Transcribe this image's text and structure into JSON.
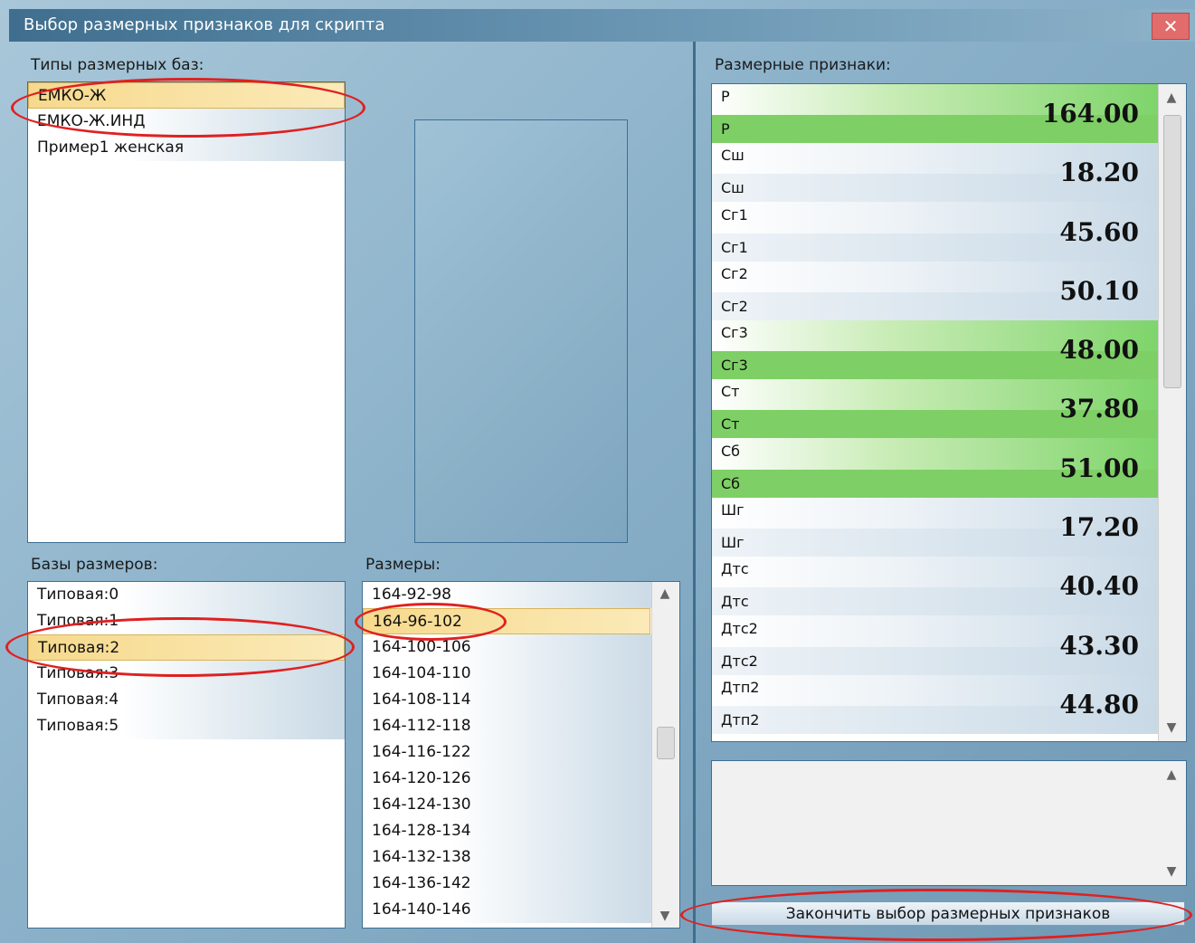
{
  "window": {
    "title": "Выбор размерных признаков для скрипта",
    "close_glyph": "✕"
  },
  "types_panel": {
    "label": "Типы размерных баз:",
    "items": [
      "ЕМКО-Ж",
      "ЕМКО-Ж.ИНД",
      "Пример1 женская"
    ],
    "selected_index": 0
  },
  "bases_panel": {
    "label": "Базы размеров:",
    "items": [
      "Типовая:0",
      "Типовая:1",
      "Типовая:2",
      "Типовая:3",
      "Типовая:4",
      "Типовая:5"
    ],
    "selected_index": 2
  },
  "sizes_panel": {
    "label": "Размеры:",
    "items": [
      "164-92-98",
      "164-96-102",
      "164-100-106",
      "164-104-110",
      "164-108-114",
      "164-112-118",
      "164-116-122",
      "164-120-126",
      "164-124-130",
      "164-128-134",
      "164-132-138",
      "164-136-142",
      "164-140-146"
    ],
    "selected_index": 1
  },
  "attributes_panel": {
    "label": "Размерные признаки:",
    "rows": [
      {
        "name": "Р",
        "sub": "Р",
        "value": "164.00",
        "highlighted": true
      },
      {
        "name": "Сш",
        "sub": "Сш",
        "value": "18.20",
        "highlighted": false
      },
      {
        "name": "Сг1",
        "sub": "Сг1",
        "value": "45.60",
        "highlighted": false
      },
      {
        "name": "Сг2",
        "sub": "Сг2",
        "value": "50.10",
        "highlighted": false
      },
      {
        "name": "Сг3",
        "sub": "Сг3",
        "value": "48.00",
        "highlighted": true
      },
      {
        "name": "Ст",
        "sub": "Ст",
        "value": "37.80",
        "highlighted": true
      },
      {
        "name": "Сб",
        "sub": "Сб",
        "value": "51.00",
        "highlighted": true
      },
      {
        "name": "Шг",
        "sub": "Шг",
        "value": "17.20",
        "highlighted": false
      },
      {
        "name": "Дтс",
        "sub": "Дтс",
        "value": "40.40",
        "highlighted": false
      },
      {
        "name": "Дтс2",
        "sub": "Дтс2",
        "value": "43.30",
        "highlighted": false
      },
      {
        "name": "Дтп2",
        "sub": "Дтп2",
        "value": "44.80",
        "highlighted": false
      }
    ]
  },
  "finish_button": {
    "label": "Закончить выбор размерных признаков"
  },
  "colors": {
    "annotation": "#e02020",
    "selection": "#f6d98c",
    "highlight_row": "#7ecf66",
    "title_bar": "#3f6e8e"
  },
  "icons": {
    "close": "close-icon",
    "scroll_up": "arrow-up-icon",
    "scroll_down": "arrow-down-icon"
  }
}
